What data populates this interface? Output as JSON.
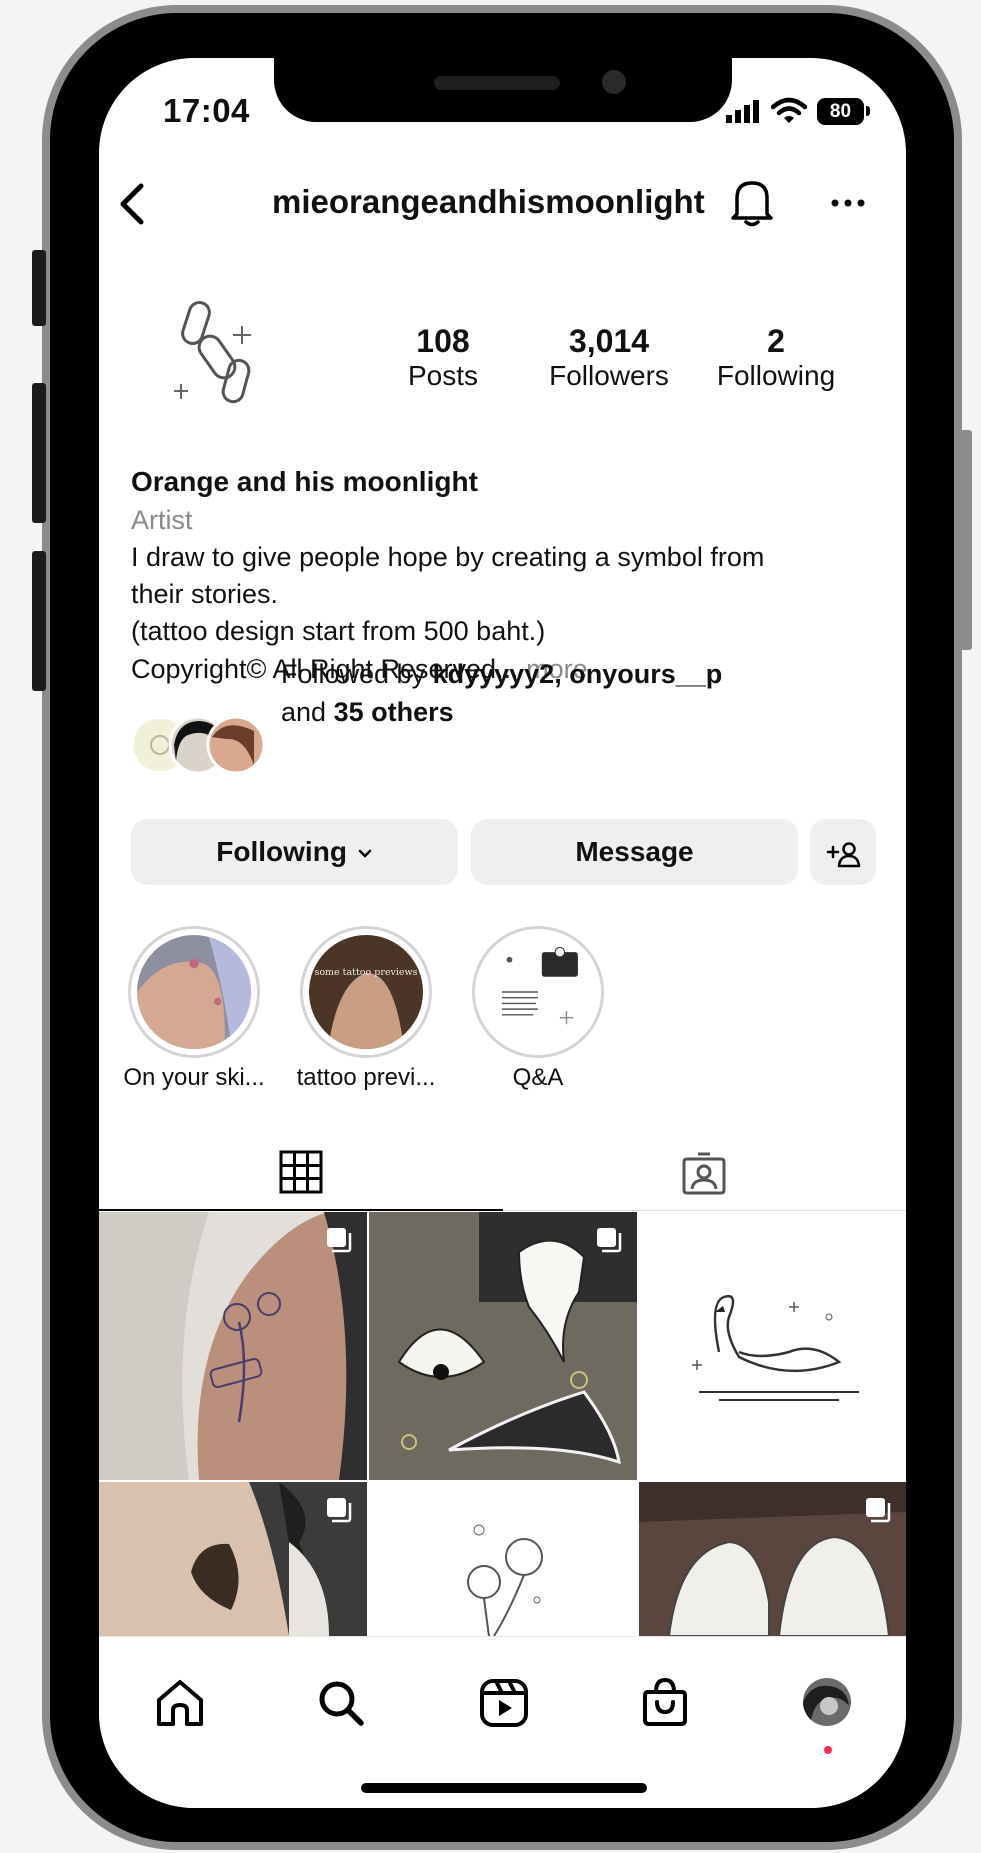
{
  "status_bar": {
    "time": "17:04",
    "battery": "80"
  },
  "header": {
    "username": "mieorangeandhismoonlight"
  },
  "stats": [
    {
      "value": "108",
      "label": "Posts"
    },
    {
      "value": "3,014",
      "label": "Followers"
    },
    {
      "value": "2",
      "label": "Following"
    }
  ],
  "bio": {
    "name": "Orange and his moonlight",
    "category": "Artist",
    "line1": "I draw to give people hope by creating a symbol from",
    "line2": "their stories.",
    "line3": "(tattoo design start from 500 baht.)",
    "line4": "Copyright© All Right Reserved...",
    "more": "more"
  },
  "followed_by": {
    "prefix": "Followed by",
    "user1": "kdyyyyy2,",
    "user2": "onyours__p",
    "and": "and",
    "others": "35 others"
  },
  "buttons": {
    "following": "Following",
    "message": "Message"
  },
  "highlights": [
    {
      "label": "On your ski..."
    },
    {
      "label": "tattoo previ..."
    },
    {
      "label": "Q&A"
    }
  ],
  "highlight_2_text": "some tattoo previews",
  "colors": {
    "accent_dot": "#ff2d55",
    "button_bg": "#efefef",
    "muted_text": "#8a8a8a"
  }
}
